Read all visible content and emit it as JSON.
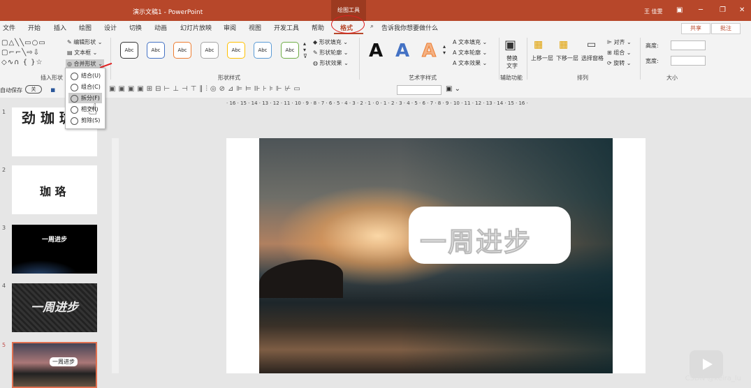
{
  "window": {
    "title": "演示文稿1 - PowerPoint",
    "context_tool": "绘图工具",
    "user": "王 佳雯"
  },
  "tabs": [
    "文件",
    "开始",
    "插入",
    "绘图",
    "设计",
    "切换",
    "动画",
    "幻灯片放映",
    "审阅",
    "视图",
    "开发工具",
    "帮助",
    "格式"
  ],
  "active_tab": "格式",
  "search_placeholder": "告诉我你想要做什么",
  "share_label": "共享",
  "comment_label": "批注",
  "ribbon": {
    "insert_shapes": {
      "edit_shape": "编辑形状",
      "textbox": "文本框",
      "merge_shapes": "合并形状",
      "label": "插入形状"
    },
    "shape_styles": {
      "presets": [
        "Abc",
        "Abc",
        "Abc",
        "Abc",
        "Abc",
        "Abc",
        "Abc"
      ],
      "fill": "形状填充",
      "outline": "形状轮廓",
      "effects": "形状效果",
      "label": "形状样式"
    },
    "wordart": {
      "text_fill": "文本填充",
      "text_outline": "文本轮廓",
      "text_effects": "文本效果",
      "label": "艺术字样式"
    },
    "accessibility": {
      "alt_text": "替换文字",
      "label": "辅助功能"
    },
    "arrange": {
      "bring_forward": "上移一层",
      "send_backward": "下移一层",
      "selection_pane": "选择窗格",
      "align": "对齐",
      "group": "组合",
      "rotate": "旋转",
      "label": "排列"
    },
    "size": {
      "height_label": "高度:",
      "width_label": "宽度:",
      "label": "大小"
    }
  },
  "autosave": {
    "label": "自动保存",
    "state": "关"
  },
  "merge_menu": [
    "结合(U)",
    "组合(C)",
    "拆分(F)",
    "相交(I)",
    "剪除(S)"
  ],
  "merge_menu_selected": "拆分(F)",
  "ruler_h": "· 16 · 15 · 14 · 13 · 12 · 11 · 10 · 9 · 8 · 7 · 6 · 5 · 4 · 3 · 2 · 1 · 0 · 1 · 2 · 3 · 4 · 5 · 6 · 7 · 8 · 9 · 10 · 11 · 12 · 13 · 14 · 15 · 16 ·",
  "slides": [
    {
      "number": "1",
      "text": "劲 珈 珈"
    },
    {
      "number": "2",
      "text": "珈 珞"
    },
    {
      "number": "3",
      "text": "一周进步"
    },
    {
      "number": "4",
      "text": "一周进步"
    },
    {
      "number": "5",
      "text": "一周进步"
    }
  ],
  "slide_text": "一周进步",
  "watermark": "CSDN @keira_lu",
  "colors": {
    "accent": "#b7472a",
    "annotation": "#e02020"
  }
}
